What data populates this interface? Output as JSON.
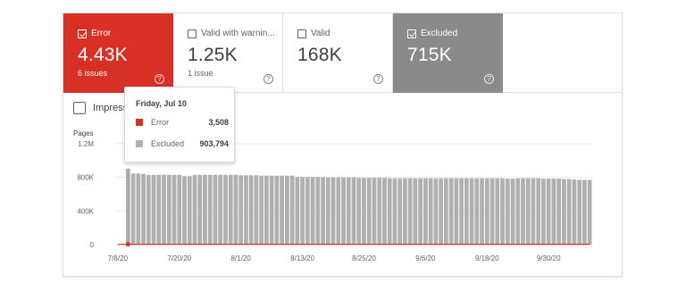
{
  "tiles": [
    {
      "label": "Error",
      "value": "4.43K",
      "sub": "6 issues",
      "checked": true,
      "kind": "error"
    },
    {
      "label": "Valid with warnin...",
      "value": "1.25K",
      "sub": "1 issue",
      "checked": false,
      "kind": "valid-warn"
    },
    {
      "label": "Valid",
      "value": "168K",
      "sub": "",
      "checked": false,
      "kind": "valid"
    },
    {
      "label": "Excluded",
      "value": "715K",
      "sub": "",
      "checked": true,
      "kind": "excluded"
    }
  ],
  "help_glyph": "?",
  "impressions_label": "Impress",
  "tooltip": {
    "date": "Friday, Jul 10",
    "rows": [
      {
        "name": "Error",
        "value": "3,508",
        "color": "#d93025"
      },
      {
        "name": "Excluded",
        "value": "903,794",
        "color": "#b0b0b0"
      }
    ]
  },
  "colors": {
    "error": "#d93025",
    "excluded": "#b0b0b0",
    "grid": "#e8eaed"
  },
  "chart_data": {
    "type": "bar",
    "ylabel": "Pages",
    "y_ticks": [
      "1.2M",
      "800K",
      "400K",
      "0"
    ],
    "ylim": [
      0,
      1200000
    ],
    "x_tick_labels": [
      "7/8/20",
      "7/20/20",
      "8/1/20",
      "8/13/20",
      "8/25/20",
      "9/6/20",
      "9/18/20",
      "9/30/20"
    ],
    "x_tick_index": [
      0,
      12,
      24,
      36,
      48,
      60,
      72,
      84
    ],
    "series": [
      {
        "name": "Excluded",
        "values": [
          0,
          0,
          903794,
          845000,
          845000,
          840000,
          830000,
          830000,
          830000,
          830000,
          830000,
          830000,
          830000,
          815000,
          815000,
          830000,
          830000,
          830000,
          830000,
          830000,
          830000,
          830000,
          830000,
          830000,
          825000,
          825000,
          825000,
          825000,
          820000,
          820000,
          820000,
          820000,
          820000,
          820000,
          820000,
          805000,
          805000,
          805000,
          805000,
          805000,
          805000,
          800000,
          800000,
          800000,
          800000,
          800000,
          800000,
          795000,
          795000,
          795000,
          795000,
          795000,
          795000,
          790000,
          790000,
          790000,
          790000,
          790000,
          790000,
          790000,
          790000,
          790000,
          790000,
          790000,
          790000,
          790000,
          790000,
          790000,
          790000,
          790000,
          790000,
          790000,
          790000,
          790000,
          790000,
          790000,
          785000,
          785000,
          790000,
          790000,
          790000,
          790000,
          790000,
          785000,
          785000,
          785000,
          785000,
          780000,
          780000,
          775000,
          770000,
          770000,
          770000
        ]
      },
      {
        "name": "Error",
        "values": [
          3508,
          3508,
          3508,
          4000,
          4000,
          4000,
          4000,
          4000,
          4000,
          4000,
          4000,
          4000,
          4000,
          4000,
          4000,
          4000,
          4000,
          4000,
          4000,
          4000,
          4000,
          4000,
          4000,
          4000,
          4000,
          4000,
          4000,
          4000,
          4000,
          4000,
          4000,
          4000,
          4000,
          4000,
          4000,
          4000,
          4000,
          4000,
          4000,
          4000,
          4000,
          4000,
          4000,
          4000,
          4000,
          4000,
          4000,
          4000,
          4000,
          4000,
          4000,
          4000,
          4000,
          4000,
          4000,
          4000,
          4000,
          4000,
          4000,
          4000,
          4000,
          4000,
          4000,
          4000,
          4000,
          4000,
          4000,
          4000,
          4000,
          4000,
          4000,
          4000,
          4000,
          4000,
          4000,
          4000,
          4000,
          4000,
          4000,
          4000,
          4000,
          4000,
          4000,
          4000,
          4000,
          4000,
          4000,
          4000,
          4000,
          4000,
          4000,
          4000,
          4430
        ]
      }
    ]
  }
}
